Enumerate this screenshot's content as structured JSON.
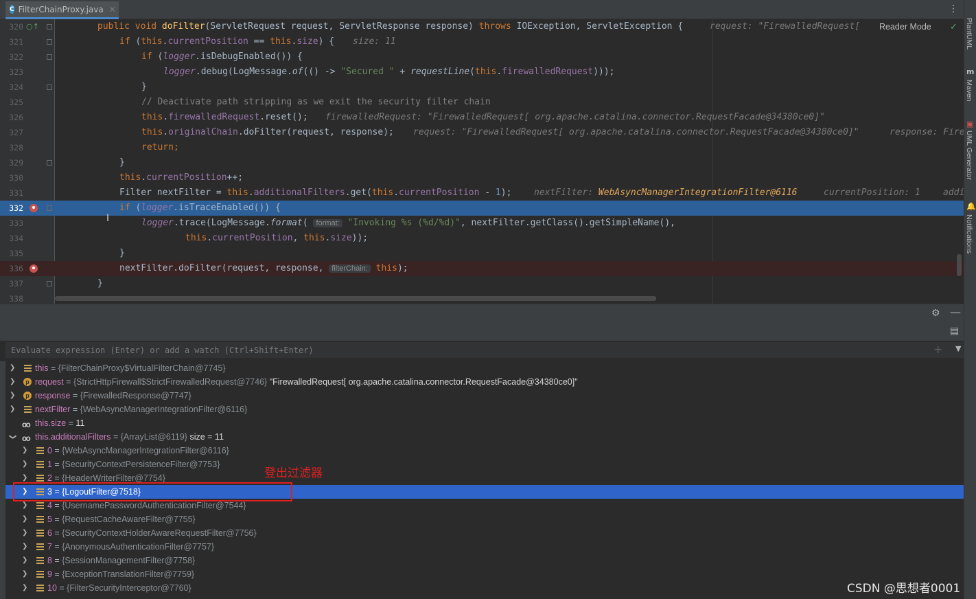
{
  "tab": {
    "filename": "FilterChainProxy.java",
    "icon": "C"
  },
  "editor": {
    "reader_mode": "Reader Mode",
    "lines": [
      {
        "n": "320"
      },
      {
        "n": "321"
      },
      {
        "n": "322"
      },
      {
        "n": "323"
      },
      {
        "n": "324"
      },
      {
        "n": "325"
      },
      {
        "n": "326"
      },
      {
        "n": "327"
      },
      {
        "n": "328"
      },
      {
        "n": "329"
      },
      {
        "n": "330"
      },
      {
        "n": "331"
      },
      {
        "n": "332"
      },
      {
        "n": "333"
      },
      {
        "n": "334"
      },
      {
        "n": "335"
      },
      {
        "n": "336"
      },
      {
        "n": "337"
      },
      {
        "n": "338"
      }
    ],
    "code": {
      "l320_kw1": "public void ",
      "l320_fn": "doFilter",
      "l320_rest": "(ServletRequest request, ServletResponse response) ",
      "l320_kw2": "throws ",
      "l320_rest2": "IOException, ServletException {",
      "l320_hint": "request: \"FirewalledRequest[",
      "l321_kw": "if ",
      "l321_a": "(",
      "l321_this": "this",
      "l321_b": ".",
      "l321_fld": "currentPosition",
      "l321_c": " == ",
      "l321_this2": "this",
      "l321_d": ".",
      "l321_fld2": "size",
      "l321_e": ") {",
      "l321_hint": "size: 11",
      "l322_kw": "if ",
      "l322_a": "(",
      "l322_fld": "logger",
      "l322_b": ".isDebugEnabled()) {",
      "l323_fld": "logger",
      "l323_a": ".debug(LogMessage.",
      "l323_of": "of",
      "l323_b": "(() -> ",
      "l323_str": "\"Secured \"",
      "l323_c": " + ",
      "l323_rl": "requestLine",
      "l323_d": "(",
      "l323_this": "this",
      "l323_e": ".",
      "l323_fld2": "firewalledRequest",
      "l323_f": ")));",
      "l324": "}",
      "l325": "// Deactivate path stripping as we exit the security filter chain",
      "l326_this": "this",
      "l326_a": ".",
      "l326_fld": "firewalledRequest",
      "l326_b": ".reset();",
      "l326_hint": "firewalledRequest: \"FirewalledRequest[ org.apache.catalina.connector.RequestFacade@34380ce0]\"",
      "l327_this": "this",
      "l327_a": ".",
      "l327_fld": "originalChain",
      "l327_b": ".doFilter(request, response);",
      "l327_hint": "request: \"FirewalledRequest[ org.apache.catalina.connector.RequestFacade@34380ce0]\"",
      "l327_hint2": "response: Fire",
      "l328_kw": "return;",
      "l329": "}",
      "l330_this": "this",
      "l330_a": ".",
      "l330_fld": "currentPosition",
      "l330_b": "++;",
      "l331_a": "Filter nextFilter = ",
      "l331_this": "this",
      "l331_b": ".",
      "l331_fld": "additionalFilters",
      "l331_c": ".get(",
      "l331_this2": "this",
      "l331_d": ".",
      "l331_fld2": "currentPosition",
      "l331_e": " - ",
      "l331_num": "1",
      "l331_f": ");",
      "l331_hint": "nextFilter: ",
      "l331_hintobj": "WebAsyncManagerIntegrationFilter@6116",
      "l331_hint2": "currentPosition: 1",
      "l331_hint3": "addi",
      "l332_kw": "if ",
      "l332_a": "(",
      "l332_fld": "logger",
      "l332_b": ".isTraceEnabled()) {",
      "l333_fld": "logger",
      "l333_a": ".trace(LogMessage.",
      "l333_fmt": "format",
      "l333_b": "( ",
      "l333_param": "format:",
      "l333_str": " \"Invoking %s (%d/%d)\"",
      "l333_c": ", nextFilter.getClass().getSimpleName(),",
      "l334_this": "this",
      "l334_a": ".",
      "l334_fld": "currentPosition",
      "l334_b": ", ",
      "l334_this2": "this",
      "l334_c": ".",
      "l334_fld2": "size",
      "l334_d": "));",
      "l335": "}",
      "l336_a": "nextFilter.doFilter(request, response, ",
      "l336_param": "filterChain:",
      "l336_this": " this",
      "l336_b": ");",
      "l337": "}"
    }
  },
  "right_strip": {
    "plantuml": "PlantUML",
    "maven": "Maven",
    "uml_generator": "UML Generator",
    "notifications": "Notifications"
  },
  "debug": {
    "eval_placeholder": "Evaluate expression (Enter) or add a watch (Ctrl+Shift+Enter)",
    "variables": [
      {
        "name": "this",
        "value": "{FilterChainProxy$VirtualFilterChain@7745}",
        "extra": "",
        "icon": "field"
      },
      {
        "name": "request",
        "value": "{StrictHttpFirewall$StrictFirewalledRequest@7746}",
        "extra": "\"FirewalledRequest[ org.apache.catalina.connector.RequestFacade@34380ce0]\"",
        "icon": "param"
      },
      {
        "name": "response",
        "value": "{FirewalledResponse@7747}",
        "extra": "",
        "icon": "param"
      },
      {
        "name": "nextFilter",
        "value": "{WebAsyncManagerIntegrationFilter@6116}",
        "extra": "",
        "icon": "field"
      },
      {
        "name": "this.size",
        "value": "11",
        "extra": "",
        "icon": "glasses"
      },
      {
        "name": "this.additionalFilters",
        "value": "{ArrayList@6119}",
        "extra": "size = 11",
        "icon": "glasses"
      }
    ],
    "items": [
      {
        "index": "0",
        "value": "{WebAsyncManagerIntegrationFilter@6116}"
      },
      {
        "index": "1",
        "value": "{SecurityContextPersistenceFilter@7753}"
      },
      {
        "index": "2",
        "value": "{HeaderWriterFilter@7754}"
      },
      {
        "index": "3",
        "value": "{LogoutFilter@7518}"
      },
      {
        "index": "4",
        "value": "{UsernamePasswordAuthenticationFilter@7544}"
      },
      {
        "index": "5",
        "value": "{RequestCacheAwareFilter@7755}"
      },
      {
        "index": "6",
        "value": "{SecurityContextHolderAwareRequestFilter@7756}"
      },
      {
        "index": "7",
        "value": "{AnonymousAuthenticationFilter@7757}"
      },
      {
        "index": "8",
        "value": "{SessionManagementFilter@7758}"
      },
      {
        "index": "9",
        "value": "{ExceptionTranslationFilter@7759}"
      },
      {
        "index": "10",
        "value": "{FilterSecurityInterceptor@7760}"
      }
    ],
    "selected_index": 3
  },
  "annotation": "登出过滤器",
  "watermark": "CSDN @思想者0001"
}
